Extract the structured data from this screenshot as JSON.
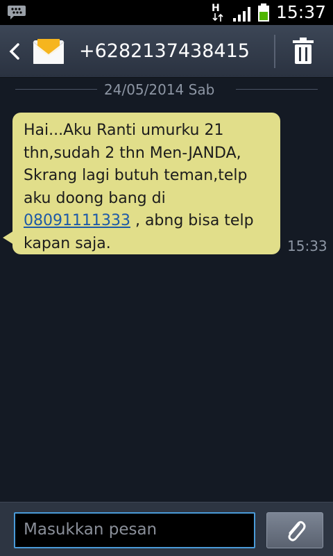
{
  "status_bar": {
    "clock": "15:37",
    "network_type": "H",
    "icons": [
      "bbm-icon",
      "network-type-icon",
      "signal-icon",
      "battery-icon"
    ]
  },
  "header": {
    "contact": "+6282137438415",
    "icons": [
      "back-arrow-icon",
      "envelope-icon",
      "trash-icon"
    ]
  },
  "thread": {
    "date": "24/05/2014 Sab",
    "messages": [
      {
        "text_before_link": "Hai...Aku Ranti umurku 21\nthn,sudah 2 thn Men-JANDA,\nSkrang lagi butuh teman,telp\naku doong bang di\n",
        "link": "08091111333",
        "text_after_link": " , abng bisa telp\nkapan saja.",
        "time": "15:33"
      }
    ]
  },
  "composer": {
    "placeholder": "Masukkan pesan",
    "icons": [
      "paperclip-icon"
    ]
  },
  "colors": {
    "bubble": "#e1de8a",
    "link": "#1e5aa6",
    "input_border": "#4a9bd9",
    "background": "#141a24"
  }
}
